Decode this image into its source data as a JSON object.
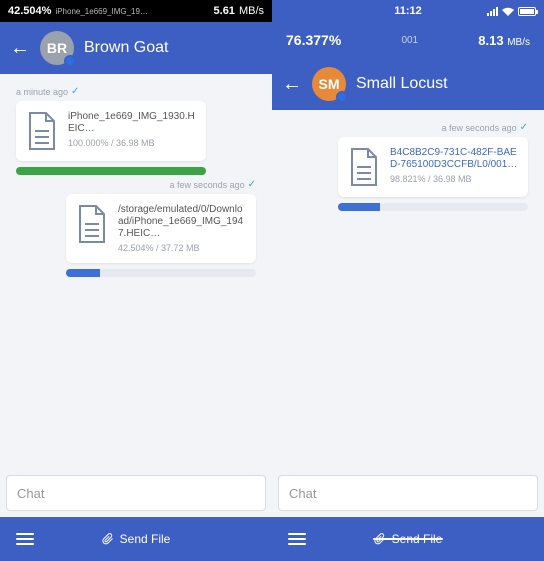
{
  "left": {
    "statusbar": {
      "pct": "42.504%",
      "file_hint": "iPhone_1e669_IMG_19…",
      "rate_val": "5.61",
      "rate_unit": "MB/s"
    },
    "header": {
      "name": "Brown Goat",
      "initials": "BR"
    },
    "messages": [
      {
        "side": "left",
        "ts": "a minute ago",
        "filename": "iPhone_1e669_IMG_1930.HEIC…",
        "meta": "100.000% / 36.98 MB",
        "progress_pct": 100,
        "bar_color": "green"
      },
      {
        "side": "right",
        "ts": "a few seconds ago",
        "filename": "/storage/emulated/0/Download/iPhone_1e669_IMG_1947.HEIC…",
        "meta": "42.504% / 37.72 MB",
        "progress_pct": 18,
        "bar_color": "blue"
      }
    ],
    "chat_placeholder": "Chat",
    "send_label": "Send File"
  },
  "right": {
    "statusbar": {
      "time": "11:12"
    },
    "progress": {
      "pct": "76.377%",
      "mid": "001",
      "rate_val": "8.13",
      "rate_unit": "MB/s"
    },
    "header": {
      "name": "Small Locust",
      "initials": "SM"
    },
    "messages": [
      {
        "side": "right",
        "ts": "a few seconds ago",
        "filename": "B4C8B2C9-731C-482F-BAED-765100D3CCFB/L0/001…",
        "meta": "98.821% / 36.98 MB",
        "progress_pct": 22,
        "bar_color": "blue",
        "highlight": true
      }
    ],
    "chat_placeholder": "Chat",
    "send_label": "Send File"
  }
}
